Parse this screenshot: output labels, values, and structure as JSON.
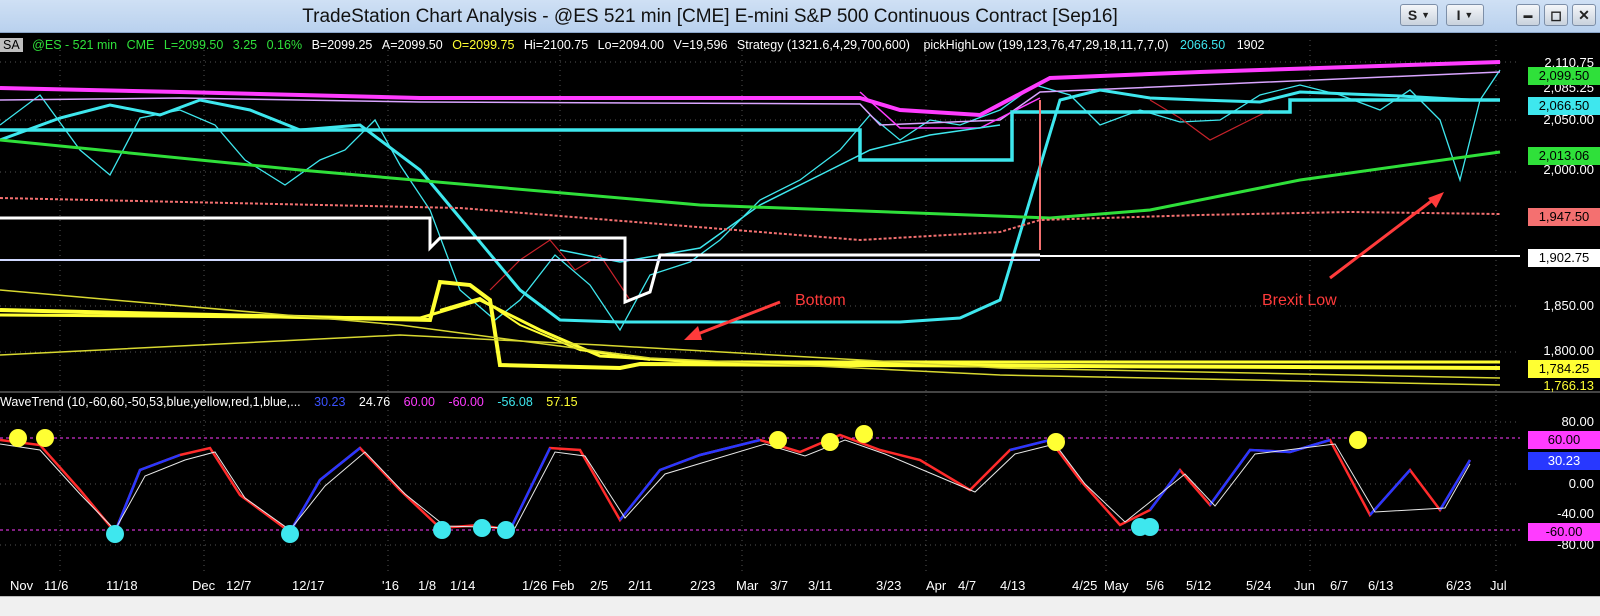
{
  "window": {
    "title": "TradeStation Chart Analysis - @ES 521 min [CME] E-mini S&P 500 Continuous Contract [Sep16]",
    "btn_s": "S",
    "btn_i": "I",
    "btn_min": "▬",
    "btn_max": "◻",
    "btn_close": "✕"
  },
  "colors": {
    "magenta": "#ff3cff",
    "cyan": "#3ee7ee",
    "green": "#2fe03a",
    "yellow": "#ffff33",
    "white": "#ffffff",
    "salmon": "#f47070",
    "red": "#ff2b2b",
    "blue": "#2838ff",
    "lavender": "#d9a4ff"
  },
  "header": {
    "sa": "SA",
    "sym": "@ES - 521 min",
    "exch": "CME",
    "last": "L=2099.50",
    "chg": "3.25",
    "pct": "0.16%",
    "bid": "B=2099.25",
    "ask": "A=2099.50",
    "open": "O=2099.75",
    "hi": "Hi=2100.75",
    "lo": "Lo=2094.00",
    "vol": "V=19,596",
    "strategy": "Strategy (1321.6,4,29,700,600)",
    "phl": "pickHighLow (199,123,76,47,29,18,11,7,7,0)",
    "phl_v1": "2066.50",
    "phl_v2": "1902"
  },
  "wave_header": {
    "label": "WaveTrend (10,-60,60,-50,53,blue,yellow,red,1,blue,...",
    "v1": "30.23",
    "v2": "24.76",
    "v3": "60.00",
    "v4": "-60.00",
    "v5": "-56.08",
    "v6": "57.15"
  },
  "price_axis": {
    "ticks": [
      "2,110.75",
      "2,085.25",
      "2,050.00",
      "2,000.00",
      "1,850.00",
      "1,800.00",
      "1,766.13"
    ],
    "tags": [
      {
        "label": "2,099.50",
        "bg": "#2fe03a"
      },
      {
        "label": "2,066.50",
        "bg": "#3ee7ee"
      },
      {
        "label": "2,013.06",
        "bg": "#2fe03a"
      },
      {
        "label": "1,947.50",
        "bg": "#f47070"
      },
      {
        "label": "1,902.75",
        "bg": "#ffffff"
      },
      {
        "label": "1,784.25",
        "bg": "#ffff33"
      }
    ]
  },
  "osc_axis": {
    "ticks": [
      "80.00",
      "0.00",
      "-40.00",
      "-80.00"
    ],
    "tags": [
      {
        "label": "60.00",
        "bg": "#ff3cff"
      },
      {
        "label": "30.23",
        "bg": "#2838ff",
        "fg": "#ffffff"
      },
      {
        "label": "-60.00",
        "bg": "#ff3cff"
      }
    ]
  },
  "time_axis": [
    "Nov",
    "11/6",
    "11/18",
    "Dec",
    "12/7",
    "12/17",
    "'16",
    "1/8",
    "1/14",
    "1/26",
    "Feb",
    "2/5",
    "2/11",
    "2/23",
    "Mar",
    "3/7",
    "3/11",
    "3/23",
    "Apr",
    "4/7",
    "4/13",
    "4/25",
    "May",
    "5/6",
    "5/12",
    "5/24",
    "Jun",
    "6/7",
    "6/13",
    "6/23",
    "Jul"
  ],
  "annotations": {
    "bottom": "Bottom",
    "brexit": "Brexit Low"
  }
}
